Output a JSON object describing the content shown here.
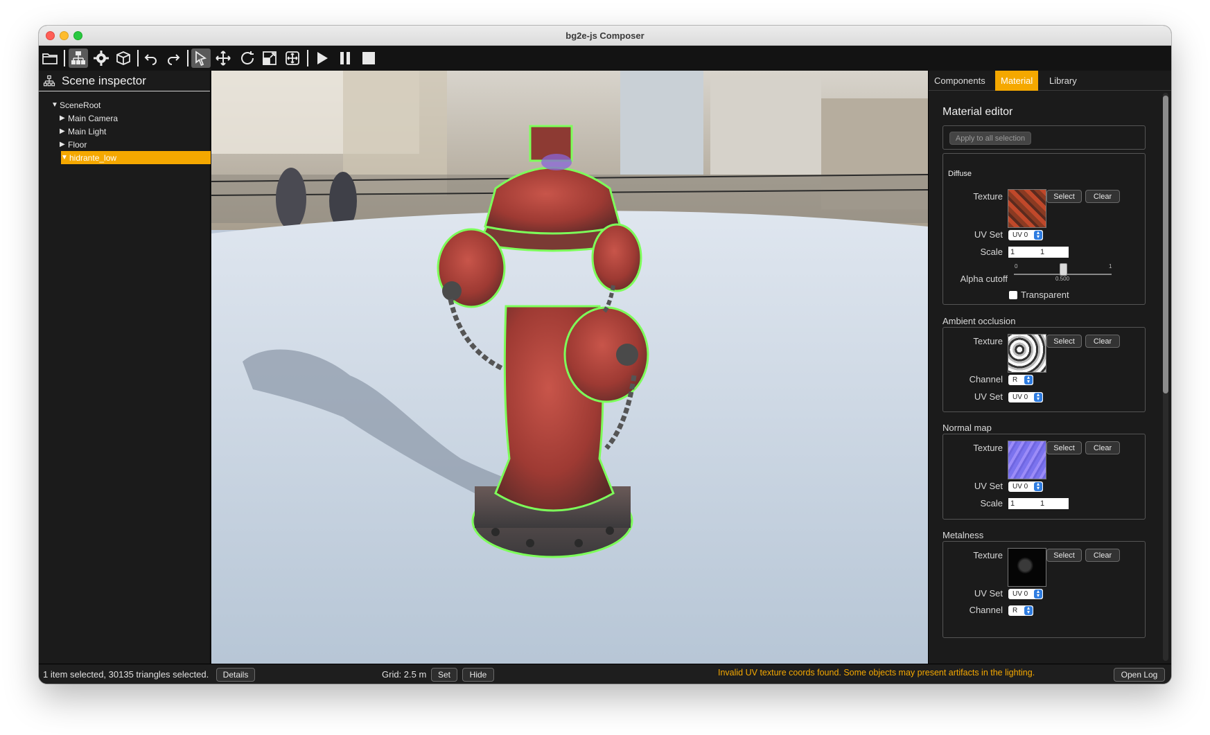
{
  "window": {
    "title": "bg2e-js Composer"
  },
  "toolbar": {
    "buttons": [
      "open-folder-icon",
      "scene-tree-icon",
      "settings-gear-icon",
      "components-icon",
      "undo-icon",
      "redo-icon",
      "select-tool-icon",
      "move-tool-icon",
      "rotate-tool-icon",
      "scale-tool-icon",
      "transform-gizmo-icon",
      "play-icon",
      "pause-icon",
      "stop-icon"
    ]
  },
  "scene_inspector": {
    "title": "Scene inspector",
    "tree": [
      {
        "label": "SceneRoot",
        "expanded": true,
        "level": 0
      },
      {
        "label": "Main Camera",
        "expanded": false,
        "level": 1
      },
      {
        "label": "Main Light",
        "expanded": false,
        "level": 1
      },
      {
        "label": "Floor",
        "expanded": false,
        "level": 1
      },
      {
        "label": "hidrante_low",
        "expanded": true,
        "level": 1,
        "selected": true
      }
    ]
  },
  "right_panel": {
    "tabs": [
      "Components",
      "Material",
      "Library"
    ],
    "active_tab": "Material",
    "material_editor": {
      "title": "Material editor",
      "apply_all_label": "Apply to all selection",
      "diffuse": {
        "title": "Diffuse",
        "texture_label": "Texture",
        "select_label": "Select",
        "clear_label": "Clear",
        "uvset_label": "UV Set",
        "uvset_value": "UV 0",
        "scale_label": "Scale",
        "scale_x": "1",
        "scale_y": "1",
        "alpha_label": "Alpha cutoff",
        "alpha_min": "0",
        "alpha_max": "1",
        "alpha_value": "0.500",
        "transparent_label": "Transparent"
      },
      "ambient_occlusion": {
        "title": "Ambient occlusion",
        "texture_label": "Texture",
        "select_label": "Select",
        "clear_label": "Clear",
        "channel_label": "Channel",
        "channel_value": "R",
        "uvset_label": "UV Set",
        "uvset_value": "UV 0"
      },
      "normal_map": {
        "title": "Normal map",
        "texture_label": "Texture",
        "select_label": "Select",
        "clear_label": "Clear",
        "uvset_label": "UV Set",
        "uvset_value": "UV 0",
        "scale_label": "Scale",
        "scale_x": "1",
        "scale_y": "1"
      },
      "metalness": {
        "title": "Metalness",
        "texture_label": "Texture",
        "select_label": "Select",
        "clear_label": "Clear",
        "uvset_label": "UV Set",
        "uvset_value": "UV 0",
        "channel_label": "Channel",
        "channel_value": "R"
      }
    }
  },
  "statusbar": {
    "selection_text": "1 item selected, 30135 triangles selected.",
    "details_label": "Details",
    "grid_text": "Grid: 2.5 m",
    "set_label": "Set",
    "hide_label": "Hide",
    "warning_text": "Invalid UV texture coords found. Some objects may present artifacts in the lighting.",
    "open_log_label": "Open Log"
  },
  "colors": {
    "accent": "#f5a800",
    "selection_outline": "#7dff5a",
    "warning": "#f5a800"
  }
}
